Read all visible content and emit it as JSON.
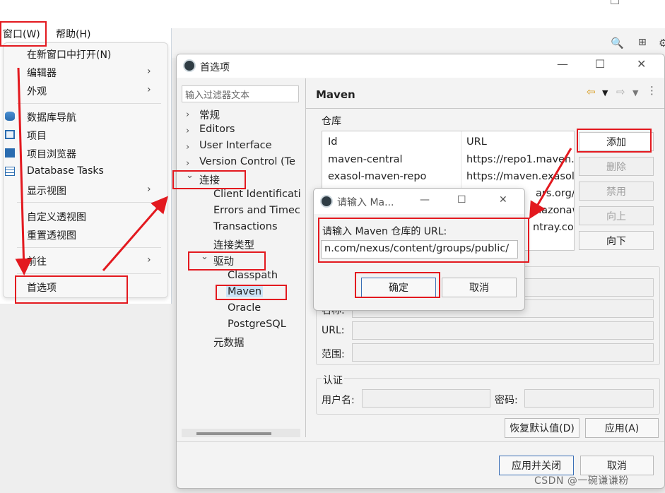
{
  "menubar": {
    "window": "窗口(W)",
    "help": "帮助(H)"
  },
  "window_menu": {
    "items": [
      {
        "label": "在新窗口中打开(N)",
        "submenu": false
      },
      {
        "label": "编辑器",
        "submenu": true
      },
      {
        "label": "外观",
        "submenu": true
      },
      {
        "label": "数据库导航",
        "submenu": false,
        "icon": "database-icon"
      },
      {
        "label": "项目",
        "submenu": false,
        "icon": "project-window-icon"
      },
      {
        "label": "项目浏览器",
        "submenu": false,
        "icon": "project-explorer-icon"
      },
      {
        "label": "Database Tasks",
        "submenu": false,
        "icon": "tasks-icon"
      },
      {
        "label": "显示视图",
        "submenu": true
      },
      {
        "label": "自定义透视图",
        "submenu": false
      },
      {
        "label": "重置透视图",
        "submenu": false
      },
      {
        "label": "前往",
        "submenu": true
      },
      {
        "label": "首选项",
        "submenu": false
      }
    ],
    "submenu_arrow": "›"
  },
  "prefs": {
    "title": "首选项",
    "filter_placeholder": "输入过滤器文本",
    "tree": [
      {
        "label": "常规",
        "level": 0,
        "expander": "›"
      },
      {
        "label": "Editors",
        "level": 0,
        "expander": "›"
      },
      {
        "label": "User Interface",
        "level": 0,
        "expander": "›"
      },
      {
        "label": "Version Control (Te",
        "level": 0,
        "expander": "›"
      },
      {
        "label": "连接",
        "level": 0,
        "expander": "⌄"
      },
      {
        "label": "Client Identificati",
        "level": 1
      },
      {
        "label": "Errors and Timec",
        "level": 1
      },
      {
        "label": "Transactions",
        "level": 1
      },
      {
        "label": "连接类型",
        "level": 1
      },
      {
        "label": "驱动",
        "level": 1,
        "expander": "⌄"
      },
      {
        "label": "Classpath",
        "level": 2
      },
      {
        "label": "Maven",
        "level": 2,
        "selected": true
      },
      {
        "label": "Oracle",
        "level": 2
      },
      {
        "label": "PostgreSQL",
        "level": 2
      },
      {
        "label": "元数据",
        "level": 1
      }
    ],
    "page_title": "Maven",
    "repo_group_label": "仓库",
    "repo_table": {
      "headers": [
        "Id",
        "URL"
      ],
      "rows": [
        [
          "maven-central",
          "https://repo1.maven."
        ],
        [
          "exasol-maven-repo",
          "https://maven.exasol"
        ],
        [
          "",
          "ars.org/re"
        ],
        [
          "",
          "mazonaws"
        ],
        [
          "",
          "ntray.con"
        ]
      ]
    },
    "side_buttons": {
      "add": "添加",
      "remove": "删除",
      "disable": "禁用",
      "up": "向上",
      "down": "向下"
    },
    "fields": {
      "name_label": "名称:",
      "url_label": "URL:",
      "scope_label": "范围:"
    },
    "auth": {
      "group_label": "认证",
      "username_label": "用户名:",
      "password_label": "密码:"
    },
    "restore_defaults": "恢复默认值(D)",
    "apply": "应用(A)",
    "apply_close": "应用并关闭",
    "cancel": "取消"
  },
  "url_dialog": {
    "title": "请输入 Ma...",
    "prompt": "请输入 Maven 仓库的 URL:",
    "value": "n.com/nexus/content/groups/public/",
    "ok": "确定",
    "cancel": "取消"
  },
  "watermark": "CSDN @一碗谦谦粉",
  "colors": {
    "annotation": "#e3191f",
    "selection": "#cce4f7"
  }
}
